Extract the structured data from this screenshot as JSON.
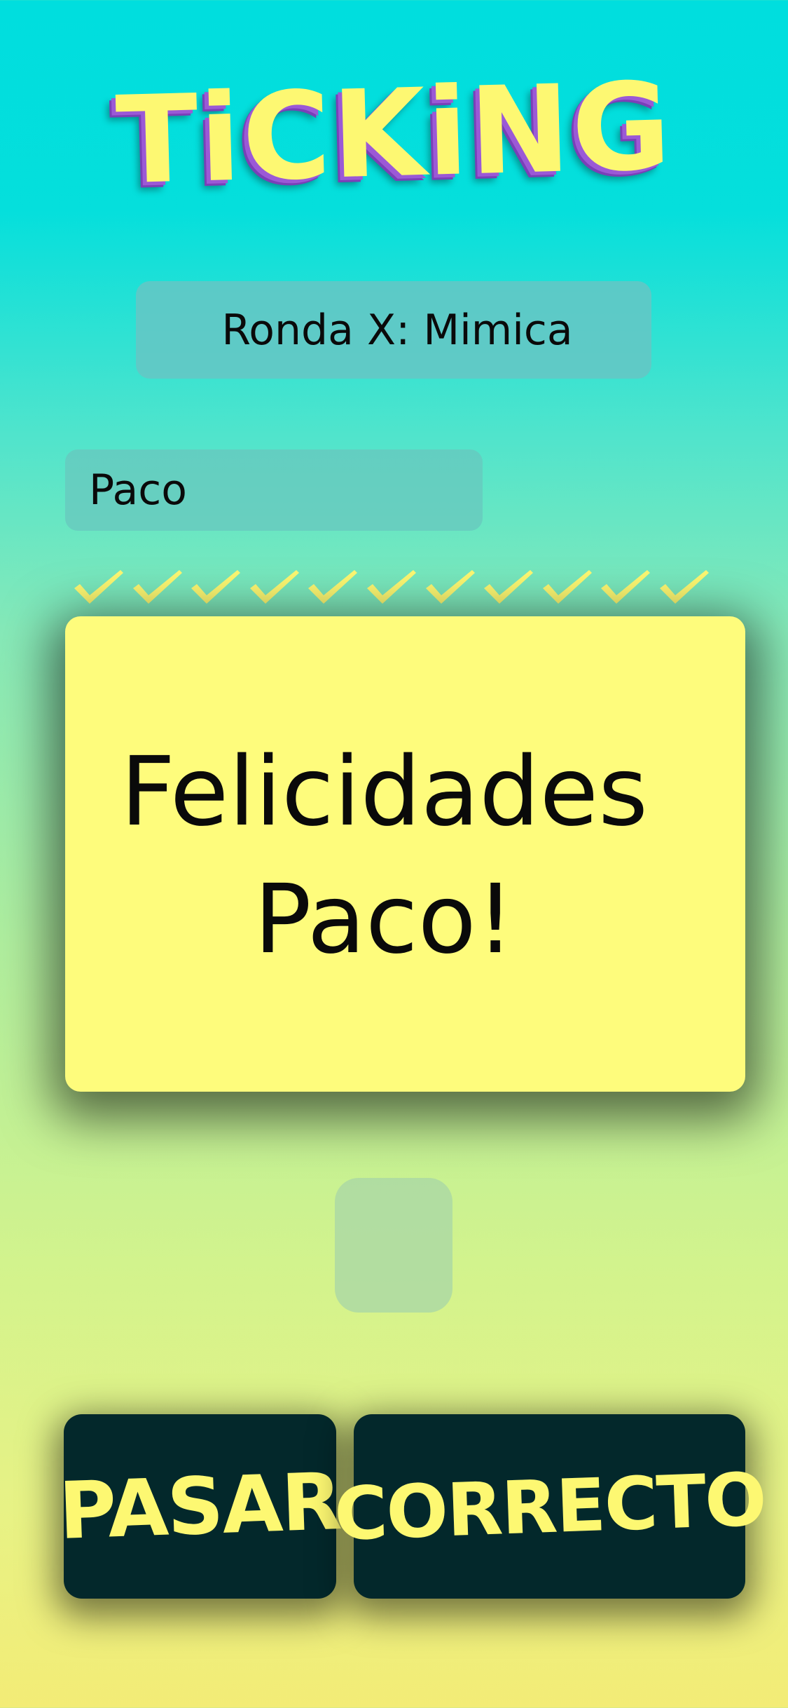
{
  "app": {
    "title": "TiCKiNG"
  },
  "round": {
    "label": "Ronda X: Mimica"
  },
  "player": {
    "name": "Paco"
  },
  "progress": {
    "checks_total": 11,
    "checks_done": 11,
    "check_color": "#fdf872"
  },
  "card": {
    "line1": "Felicidades",
    "line2": "Paco!"
  },
  "buttons": {
    "pass_label": "PASAR",
    "correct_label": "CORRECTO"
  },
  "colors": {
    "accent": "#fdf872",
    "button_bg": "#03282b",
    "card_bg": "#fefc7c",
    "title_shadow": "#9b59d6"
  }
}
